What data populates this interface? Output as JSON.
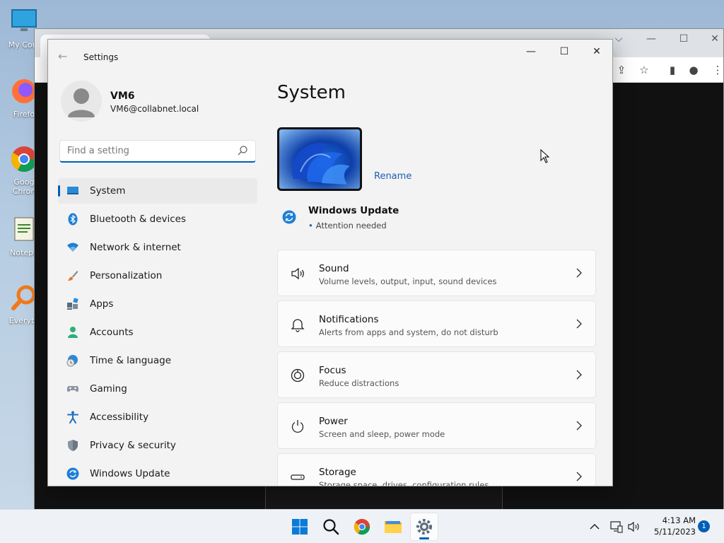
{
  "desktop": {
    "icons": [
      {
        "label": "My Com",
        "icon": "computer-icon"
      },
      {
        "label": "Firefo",
        "icon": "firefox-icon"
      },
      {
        "label": "Goog Chron",
        "icon": "chrome-icon"
      },
      {
        "label": "Notepa",
        "icon": "notepad-icon"
      },
      {
        "label": "Everyth",
        "icon": "everything-search-icon"
      }
    ]
  },
  "window": {
    "title": "Settings",
    "back_icon": "back-arrow-icon",
    "controls": {
      "minimize": "—",
      "maximize": "☐",
      "close": "✕"
    }
  },
  "profile": {
    "name": "VM6",
    "email": "VM6@collabnet.local"
  },
  "search": {
    "placeholder": "Find a setting",
    "value": ""
  },
  "nav": {
    "items": [
      {
        "label": "System",
        "icon": "system-icon",
        "selected": true
      },
      {
        "label": "Bluetooth & devices",
        "icon": "bluetooth-icon"
      },
      {
        "label": "Network & internet",
        "icon": "wifi-icon"
      },
      {
        "label": "Personalization",
        "icon": "brush-icon"
      },
      {
        "label": "Apps",
        "icon": "apps-icon"
      },
      {
        "label": "Accounts",
        "icon": "person-icon"
      },
      {
        "label": "Time & language",
        "icon": "globe-clock-icon"
      },
      {
        "label": "Gaming",
        "icon": "gamepad-icon"
      },
      {
        "label": "Accessibility",
        "icon": "accessibility-icon"
      },
      {
        "label": "Privacy & security",
        "icon": "shield-icon"
      },
      {
        "label": "Windows Update",
        "icon": "update-icon"
      }
    ]
  },
  "main": {
    "title": "System",
    "rename_label": "Rename",
    "windows_update": {
      "title": "Windows Update",
      "status": "Attention needed"
    },
    "cards": [
      {
        "title": "Sound",
        "subtitle": "Volume levels, output, input, sound devices",
        "icon": "speaker-icon"
      },
      {
        "title": "Notifications",
        "subtitle": "Alerts from apps and system, do not disturb",
        "icon": "bell-icon"
      },
      {
        "title": "Focus",
        "subtitle": "Reduce distractions",
        "icon": "focus-icon"
      },
      {
        "title": "Power",
        "subtitle": "Screen and sleep, power mode",
        "icon": "power-icon"
      },
      {
        "title": "Storage",
        "subtitle": "Storage space, drives, configuration rules",
        "icon": "storage-icon"
      }
    ]
  },
  "taskbar": {
    "apps": [
      {
        "name": "start",
        "icon": "windows-start-icon"
      },
      {
        "name": "search",
        "icon": "search-icon"
      },
      {
        "name": "chrome",
        "icon": "chrome-icon"
      },
      {
        "name": "file-explorer",
        "icon": "folder-icon"
      },
      {
        "name": "settings",
        "icon": "gear-icon",
        "active": true
      }
    ],
    "time": "4:13 AM",
    "date": "5/11/2023",
    "notification_count": "1"
  },
  "colors": {
    "accent": "#005fb8",
    "window_bg": "#f3f3f3",
    "card_bg": "#fbfbfb"
  }
}
